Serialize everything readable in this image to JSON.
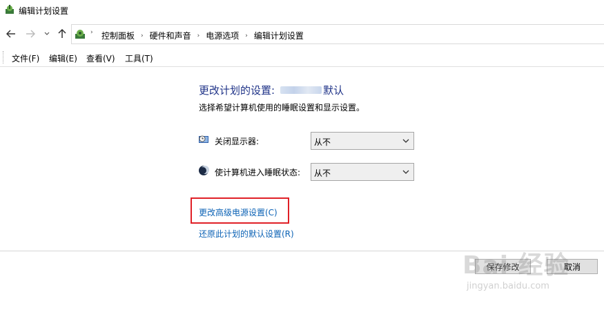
{
  "window": {
    "title": "编辑计划设置",
    "icon": "power-options-icon"
  },
  "nav": {
    "back_icon": "back-arrow-icon",
    "forward_icon": "forward-arrow-icon",
    "recent_icon": "chevron-down-icon",
    "up_icon": "up-arrow-icon"
  },
  "breadcrumb": {
    "root_icon": "control-panel-icon",
    "items": [
      {
        "label": "控制面板"
      },
      {
        "label": "硬件和声音"
      },
      {
        "label": "电源选项"
      },
      {
        "label": "编辑计划设置"
      }
    ],
    "separator": "›"
  },
  "menubar": {
    "items": [
      {
        "label": "文件(F)"
      },
      {
        "label": "编辑(E)"
      },
      {
        "label": "查看(V)"
      },
      {
        "label": "工具(T)"
      }
    ]
  },
  "main": {
    "heading_prefix": "更改计划的设置:",
    "heading_suffix": "默认",
    "subheading": "选择希望计算机使用的睡眠设置和显示设置。",
    "settings": [
      {
        "label": "关闭显示器:",
        "icon": "display-timer-icon",
        "value": "从不"
      },
      {
        "label": "使计算机进入睡眠状态:",
        "icon": "moon-sleep-icon",
        "value": "从不"
      }
    ],
    "links": {
      "advanced": "更改高级电源设置(C)",
      "restore": "还原此计划的默认设置(R)"
    }
  },
  "footer": {
    "save_label": "保存修改",
    "cancel_label": "取消"
  },
  "watermark": {
    "text": "Bai 经验",
    "url": "jingyan.baidu.com"
  },
  "colors": {
    "heading": "#1e3287",
    "link": "#0b62b5",
    "highlight": "#e01f26"
  }
}
